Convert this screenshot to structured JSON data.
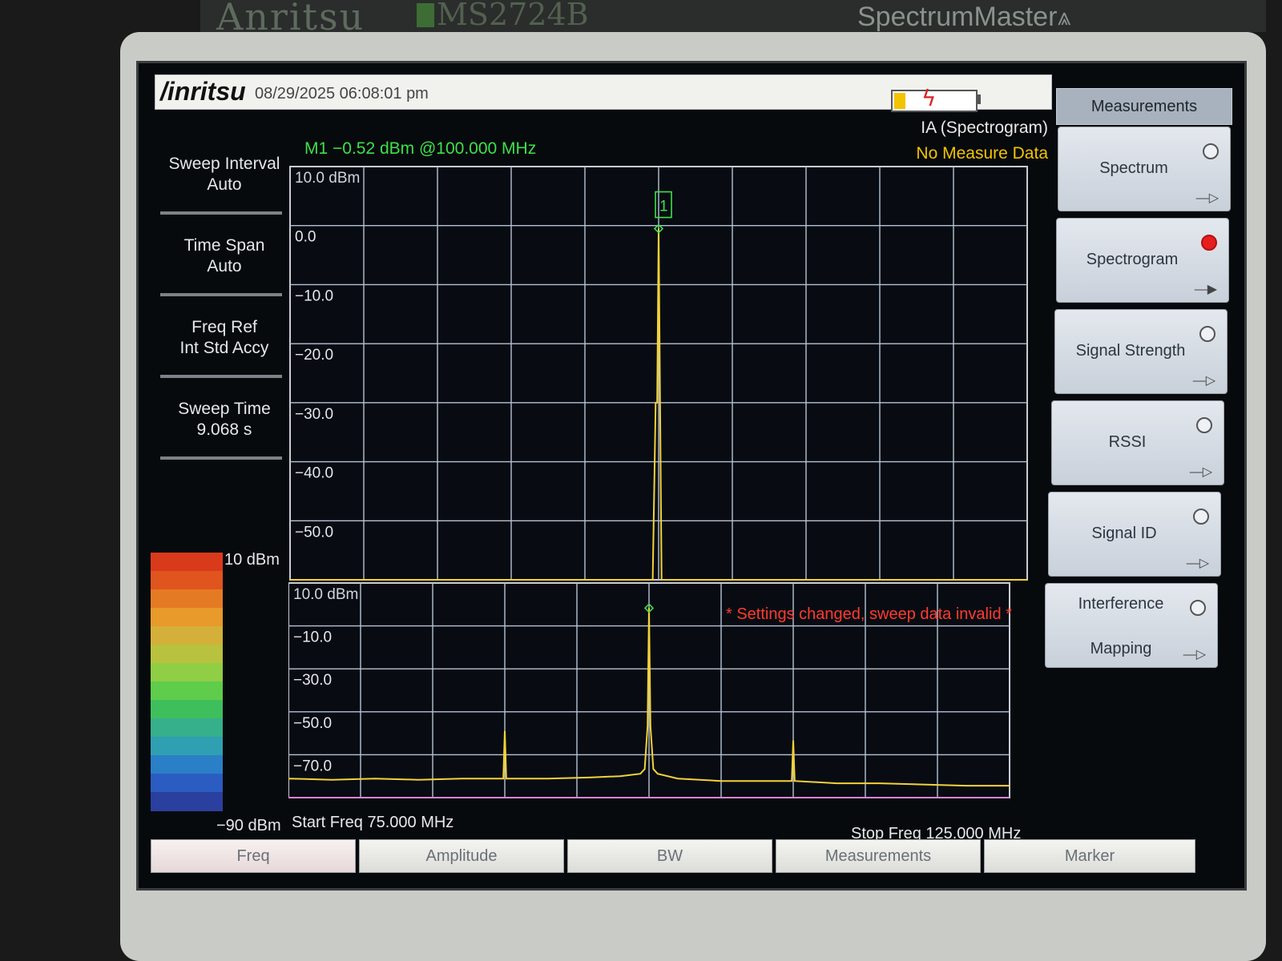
{
  "device": {
    "brand": "Anritsu",
    "model": "MS2724B",
    "product": "SpectrumMaster"
  },
  "header": {
    "logo": "/inritsu",
    "datetime": "08/29/2025 06:08:01 pm"
  },
  "left_panel": [
    {
      "line1": "Sweep Interval",
      "line2": "Auto"
    },
    {
      "line1": "Time Span",
      "line2": "Auto"
    },
    {
      "line1": "Freq Ref",
      "line2": "Int Std Accy"
    },
    {
      "line1": "Sweep Time",
      "line2": "9.068 s"
    }
  ],
  "marker_readout": "M1 −0.52 dBm @100.000 MHz",
  "mode": "IA (Spectrogram)",
  "status": "No Measure Data",
  "warning": "* Settings changed, sweep data invalid *",
  "start_freq": "Start Freq 75.000 MHz",
  "stop_freq": "Stop Freq 125.000 MHz",
  "color_scale": {
    "top": "10 dBm",
    "bottom": "−90 dBm",
    "colors": [
      "#d93a1c",
      "#e0541e",
      "#e57a24",
      "#e89a2a",
      "#d4b03a",
      "#b8c23e",
      "#8fce45",
      "#5fcc4c",
      "#3fbf5c",
      "#36b08a",
      "#2f9fb2",
      "#2a7fc6",
      "#2a5cc2",
      "#2a3f9e"
    ]
  },
  "softkeys": {
    "title": "Measurements",
    "items": [
      {
        "label": "Spectrum",
        "selected": false
      },
      {
        "label": "Spectrogram",
        "selected": true
      },
      {
        "label": "Signal Strength",
        "selected": false
      },
      {
        "label": "RSSI",
        "selected": false
      },
      {
        "label": "Signal ID",
        "selected": false
      },
      {
        "label": "Interference",
        "label2": "Mapping",
        "selected": false
      }
    ]
  },
  "tabs": [
    "Freq",
    "Amplitude",
    "BW",
    "Measurements",
    "Marker"
  ],
  "chart_data": [
    {
      "type": "line",
      "title": "M1 −0.52 dBm @100.000 MHz",
      "xlim": [
        75,
        125
      ],
      "ylim": [
        -60,
        10
      ],
      "y_tick_labels": [
        "10.0 dBm",
        "0.0",
        "−10.0",
        "−20.0",
        "−30.0",
        "−40.0",
        "−50.0"
      ],
      "grid": true,
      "series": [
        {
          "values_x": [
            75,
            99.6,
            99.8,
            99.9,
            100.0,
            100.1,
            100.2,
            125
          ],
          "values_y": [
            -60,
            -60,
            -30,
            -30,
            -0.52,
            -30,
            -60,
            -60
          ],
          "color": "#f2d23a"
        }
      ],
      "marker": {
        "label": "1",
        "x": 100.0,
        "y": -0.52
      }
    },
    {
      "type": "line",
      "xlim": [
        75,
        125
      ],
      "ylim": [
        -80,
        10
      ],
      "y_tick_labels": [
        "10.0 dBm",
        "−10.0",
        "−30.0",
        "−50.0",
        "−70.0"
      ],
      "grid": true,
      "series": [
        {
          "values_x": [
            75,
            78,
            81,
            84,
            87,
            89.9,
            90.0,
            90.1,
            93,
            96,
            98,
            99.4,
            99.7,
            99.9,
            100.0,
            100.1,
            100.3,
            100.6,
            102,
            105,
            108,
            109.9,
            110.0,
            110.1,
            113,
            116,
            119,
            122,
            125
          ],
          "values_y": [
            -72,
            -72.5,
            -72,
            -72.5,
            -72,
            -72,
            -52,
            -72,
            -72,
            -71.5,
            -71,
            -70,
            -68,
            -50,
            -0.5,
            -50,
            -68,
            -70,
            -72,
            -73,
            -73,
            -73,
            -56,
            -73,
            -74,
            -74,
            -74.5,
            -75,
            -75
          ],
          "color": "#f2d23a"
        }
      ],
      "marker": {
        "x": 100.0,
        "y": -0.52
      }
    }
  ]
}
